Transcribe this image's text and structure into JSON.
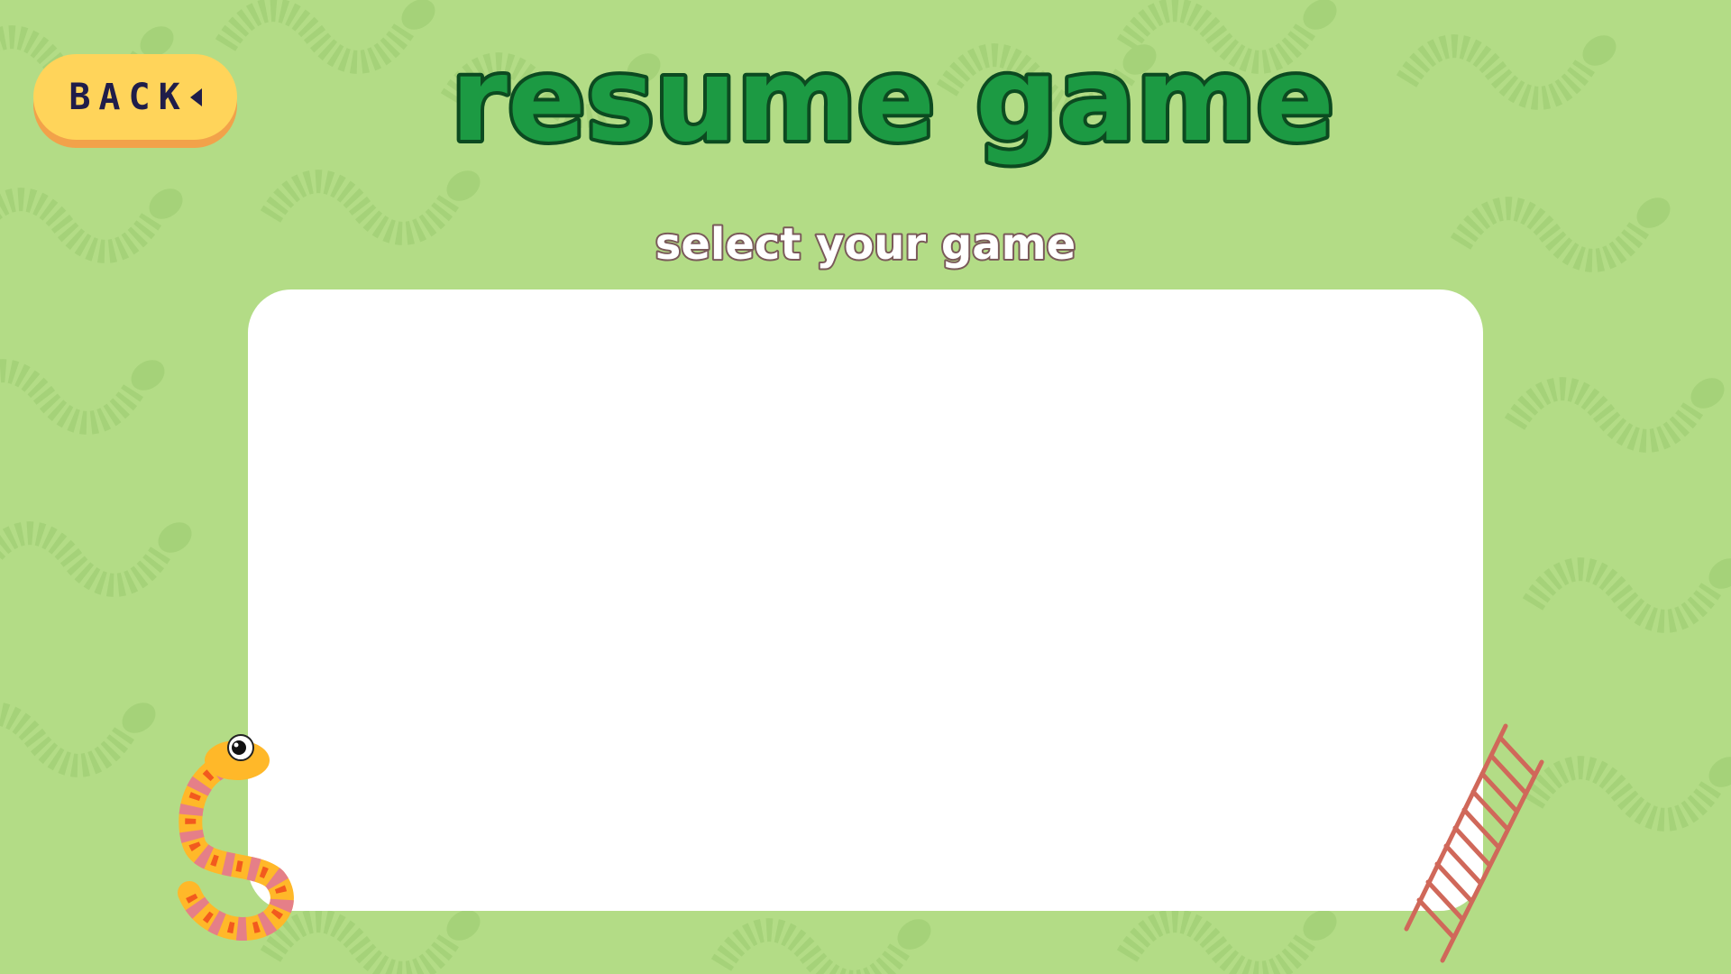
{
  "header": {
    "title": "resume game",
    "subtitle": "select your game"
  },
  "back_button": {
    "label": "BACK"
  },
  "colors": {
    "background": "#b3dc86",
    "title_fill": "#1c9a43",
    "title_outline": "#0c4a20",
    "button": "#ffd45a",
    "button_shadow": "#f2a24a",
    "panel": "#ffffff"
  },
  "icons": {
    "back": "back-arrow-icon",
    "snake": "snake-icon",
    "ladder": "ladder-icon"
  }
}
